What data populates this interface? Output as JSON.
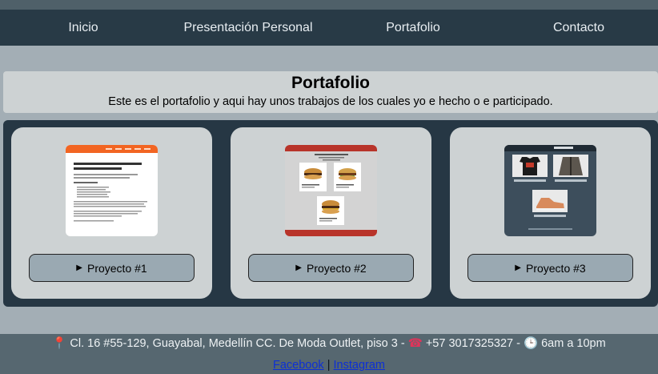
{
  "nav": {
    "items": [
      {
        "label": "Inicio"
      },
      {
        "label": "Presentación Personal"
      },
      {
        "label": "Portafolio"
      },
      {
        "label": "Contacto"
      }
    ]
  },
  "portfolio": {
    "title": "Portafolio",
    "description": "Este es el portafolio y aqui hay unos trabajos de los cuales yo e hecho o e participado."
  },
  "projects": [
    {
      "label": "Proyecto #1",
      "preview_icon": "triangle-right-icon"
    },
    {
      "label": "Proyecto #2",
      "preview_icon": "triangle-right-icon"
    },
    {
      "label": "Proyecto #3",
      "preview_icon": "triangle-right-icon"
    }
  ],
  "footer": {
    "address": "Cl. 16 #55-129, Guayabal, Medellín CC. De Moda Outlet, piso 3 -",
    "phone": "+57 3017325327 -",
    "hours": "6am a 10pm",
    "facebook": "Facebook",
    "separator": "|",
    "instagram": "Instagram"
  },
  "colors": {
    "nav_bg": "#283a46",
    "page_bg": "#a3aeb5",
    "card_bg": "#cdd2d3",
    "button_bg": "#9aa9b2",
    "gallery_bg": "#263744",
    "footer_bg": "#566770",
    "link": "#0c2fd6"
  }
}
